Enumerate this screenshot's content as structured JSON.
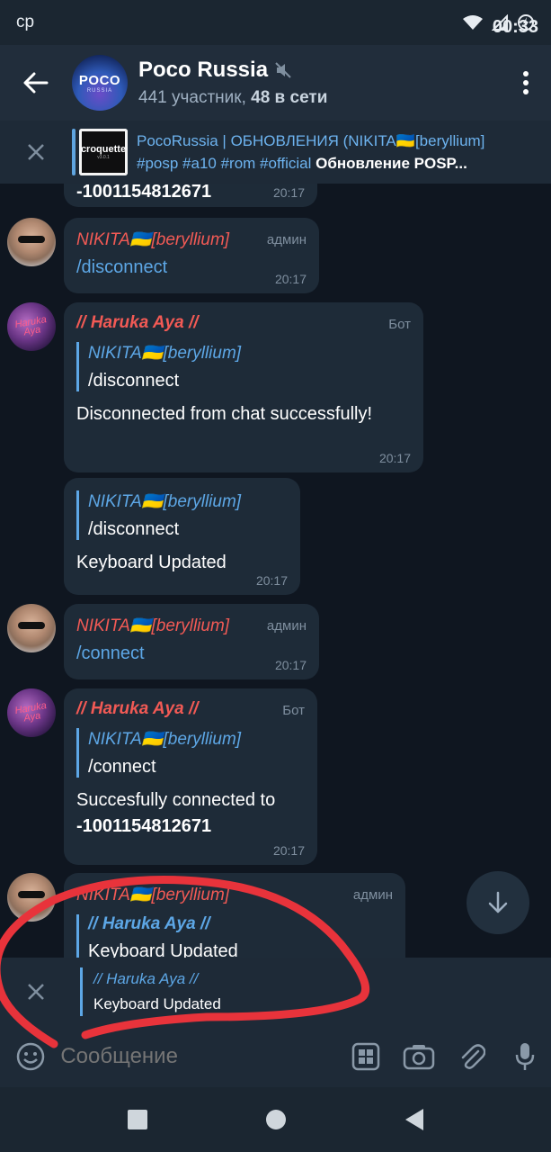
{
  "status": {
    "day": "ср",
    "time": "00:33"
  },
  "header": {
    "title": "Poco Russia",
    "members": "441 участник,",
    "online": "48 в сети",
    "avatar_line1": "POCO",
    "avatar_line2": "RUSSIA"
  },
  "pinned": {
    "thumb_name": "croquette",
    "thumb_version": "v3.0.1",
    "line1": "PocoRussia | ОБНОВЛЕНИЯ (NIKITA🇺🇦[beryllium]",
    "line2_tags": "#posp #a10 #rom #official",
    "line2_text": "Обновление POSP..."
  },
  "messages": [
    {
      "id": "m0",
      "text": "-1001154812671",
      "time": "20:17"
    },
    {
      "id": "m1",
      "sender": "NIKITA🇺🇦[beryllium]",
      "role": "админ",
      "text": "/disconnect",
      "time": "20:17"
    },
    {
      "id": "m2",
      "sender": "// Haruka Aya //",
      "role": "Бот",
      "quote_name": "NIKITA🇺🇦[beryllium]",
      "quote_text": "/disconnect",
      "text": "Disconnected from chat successfully!",
      "time": "20:17"
    },
    {
      "id": "m3",
      "quote_name": "NIKITA🇺🇦[beryllium]",
      "quote_text": "/disconnect",
      "text": "Keyboard Updated",
      "time": "20:17"
    },
    {
      "id": "m4",
      "sender": "NIKITA🇺🇦[beryllium]",
      "role": "админ",
      "text": "/connect",
      "time": "20:17"
    },
    {
      "id": "m5",
      "sender": "// Haruka Aya //",
      "role": "Бот",
      "quote_name": "NIKITA🇺🇦[beryllium]",
      "quote_text": "/connect",
      "text1": "Succesfully connected to",
      "text2": "-1001154812671",
      "time": "20:17"
    },
    {
      "id": "m6",
      "sender": "NIKITA🇺🇦[beryllium]",
      "role": "админ",
      "quote_name": "// Haruka Aya //",
      "quote_text": "Keyboard Updated"
    }
  ],
  "avatar_haruka_label": "Haruka Aya",
  "reply": {
    "name": "// Haruka Aya //",
    "text": "Keyboard Updated"
  },
  "input": {
    "placeholder": "Сообщение"
  },
  "colors": {
    "accent": "#5da7e6",
    "sender_red": "#f25a55",
    "annotation": "#e8333b"
  }
}
